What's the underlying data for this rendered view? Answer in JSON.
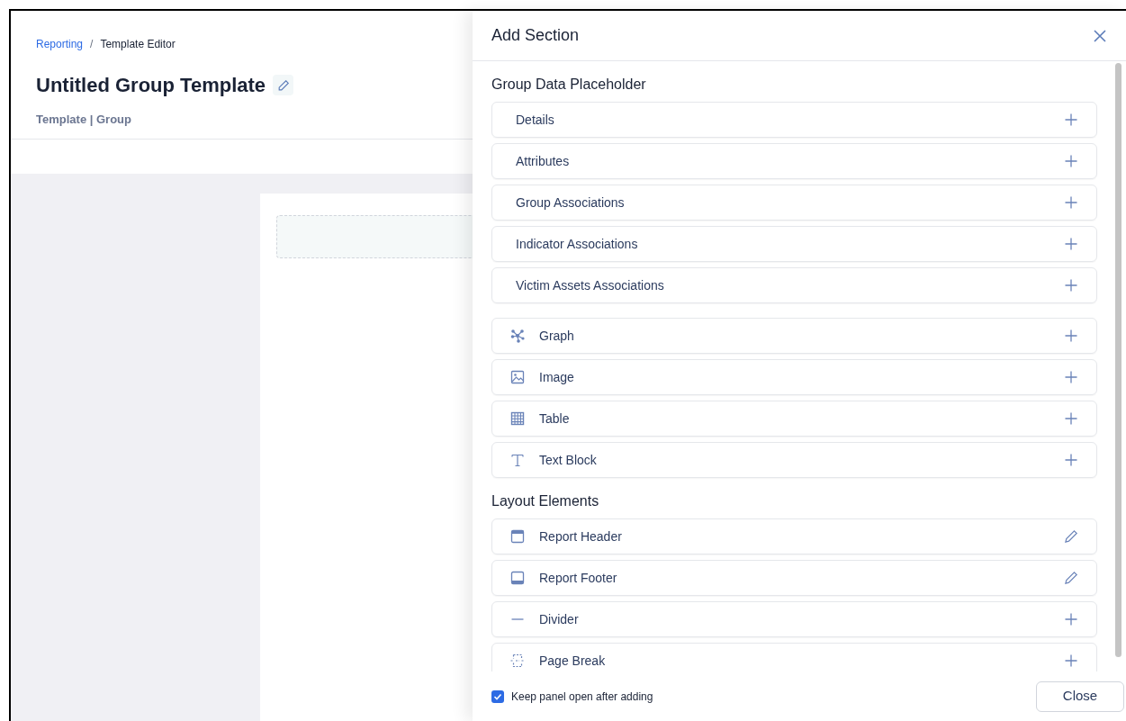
{
  "breadcrumb": {
    "separator": "/",
    "items": [
      {
        "label": "Reporting",
        "kind": "link"
      },
      {
        "label": "Template Editor",
        "kind": "current"
      }
    ]
  },
  "page": {
    "title": "Untitled Group Template",
    "subtitle": "Template | Group"
  },
  "panel": {
    "title": "Add Section",
    "sections": [
      {
        "heading": "Group Data Placeholder",
        "groups": [
          [
            {
              "label": "Details",
              "kind": "data"
            },
            {
              "label": "Attributes",
              "kind": "data"
            },
            {
              "label": "Group Associations",
              "kind": "data"
            },
            {
              "label": "Indicator Associations",
              "kind": "data"
            },
            {
              "label": "Victim Assets Associations",
              "kind": "data"
            }
          ],
          [
            {
              "label": "Graph",
              "kind": "graph"
            },
            {
              "label": "Image",
              "kind": "image"
            },
            {
              "label": "Table",
              "kind": "table"
            },
            {
              "label": "Text Block",
              "kind": "text"
            }
          ]
        ]
      },
      {
        "heading": "Layout Elements",
        "groups": [
          [
            {
              "label": "Report Header",
              "kind": "header"
            },
            {
              "label": "Report Footer",
              "kind": "footer"
            },
            {
              "label": "Divider",
              "kind": "divider"
            },
            {
              "label": "Page Break",
              "kind": "pagebreak"
            }
          ]
        ]
      }
    ],
    "keep_open": {
      "label": "Keep panel open after adding",
      "checked": true
    },
    "close_button": "Close"
  }
}
